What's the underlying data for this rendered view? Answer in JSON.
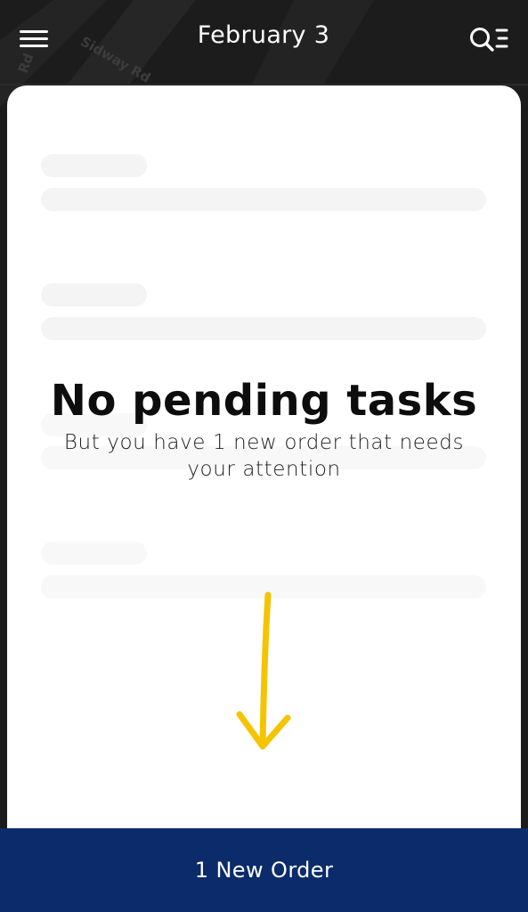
{
  "header": {
    "title": "February 3",
    "menu_icon": "hamburger-menu-icon",
    "search_icon": "search-list-icon"
  },
  "map": {
    "street_labels": [
      "Sidway Rd",
      "Rd"
    ]
  },
  "empty_state": {
    "title": "No pending tasks",
    "subtitle": "But you have 1 new order that needs your attention",
    "arrow_icon": "arrow-down-icon",
    "arrow_color": "#f5c400"
  },
  "bottom_bar": {
    "label": "1 New Order",
    "color": "#0b2b6b"
  }
}
